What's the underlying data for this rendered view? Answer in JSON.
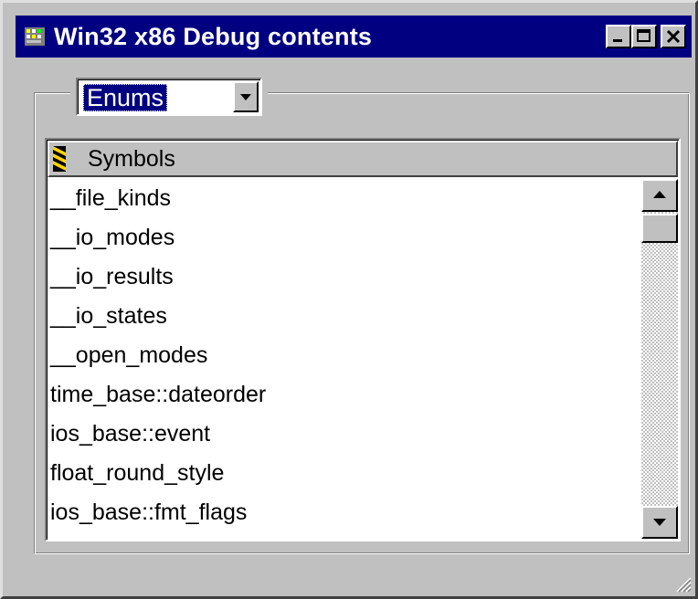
{
  "window": {
    "title": "Win32 x86 Debug contents",
    "icon": "app-window-icon",
    "caption_buttons": [
      "minimize-icon",
      "maximize-icon",
      "close-icon"
    ]
  },
  "combo": {
    "selected": "Enums",
    "arrow_icon": "chevron-down-icon"
  },
  "list": {
    "column_header": "Symbols",
    "header_icon": "symbols-column-icon",
    "items": [
      "__file_kinds",
      "__io_modes",
      "__io_results",
      "__io_states",
      "__open_modes",
      "time_base::dateorder",
      "ios_base::event",
      "float_round_style",
      "ios_base::fmt_flags"
    ]
  },
  "scrollbar": {
    "up_icon": "scroll-up-arrow-icon",
    "down_icon": "scroll-down-arrow-icon",
    "position": 0
  },
  "colors": {
    "titlebar": "#000080",
    "face": "#c0c0c0",
    "selection": "#000080"
  }
}
